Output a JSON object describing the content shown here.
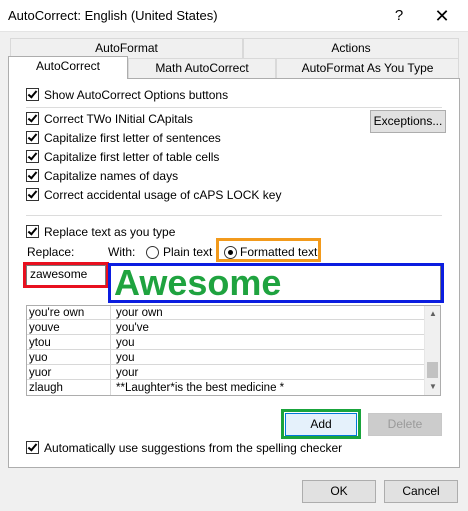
{
  "window": {
    "title": "AutoCorrect: English (United States)",
    "help_glyph": "?",
    "close_glyph": "✕"
  },
  "tabs": {
    "row1": [
      "AutoFormat",
      "Actions"
    ],
    "row2": [
      "AutoCorrect",
      "Math AutoCorrect",
      "AutoFormat As You Type"
    ],
    "active": "AutoCorrect"
  },
  "options": {
    "show_buttons": {
      "label": "Show AutoCorrect Options buttons",
      "checked": true
    },
    "two_initial": {
      "label": "Correct TWo INitial CApitals",
      "checked": true
    },
    "first_letter_sentences": {
      "label": "Capitalize first letter of sentences",
      "checked": true
    },
    "first_letter_table": {
      "label": "Capitalize first letter of table cells",
      "checked": true
    },
    "names_of_days": {
      "label": "Capitalize names of days",
      "checked": true
    },
    "caps_lock": {
      "label": "Correct accidental usage of cAPS LOCK key",
      "checked": true
    },
    "exceptions_button": "Exceptions..."
  },
  "replace": {
    "replace_text": {
      "label": "Replace text as you type",
      "checked": true
    },
    "replace_label": "Replace:",
    "with_label": "With:",
    "plain_text": "Plain text",
    "formatted_text": "Formatted text",
    "selected": "Formatted text",
    "replace_value": "zawesome",
    "with_value": "Awesome",
    "with_color": "#1fa33f"
  },
  "entries": [
    {
      "replace": "you're own",
      "with": "your own"
    },
    {
      "replace": "youve",
      "with": "you've"
    },
    {
      "replace": "ytou",
      "with": "you"
    },
    {
      "replace": "yuo",
      "with": "you"
    },
    {
      "replace": "yuor",
      "with": "your"
    },
    {
      "replace": "zlaugh",
      "with": "**Laughter*is the best medicine *"
    }
  ],
  "buttons": {
    "add": "Add",
    "delete": "Delete",
    "ok": "OK",
    "cancel": "Cancel"
  },
  "spelling": {
    "label": "Automatically use suggestions from the spelling checker",
    "checked": true
  },
  "highlight_colors": {
    "red": "#e8101f",
    "blue": "#0b1de0",
    "orange": "#f29a1c",
    "green": "#19a43c"
  }
}
